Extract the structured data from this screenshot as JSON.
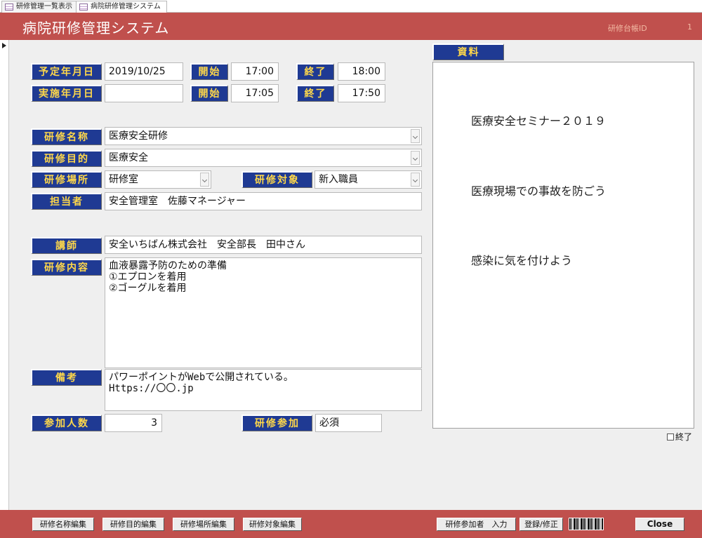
{
  "tabs": [
    {
      "label": "研修管理一覧表示"
    },
    {
      "label": "病院研修管理システム"
    }
  ],
  "header": {
    "title": "病院研修管理システム",
    "id_label": "研修台帳ID",
    "id_value": "1"
  },
  "form": {
    "scheduled_date": {
      "label": "予定年月日",
      "value": "2019/10/25",
      "start_label": "開始",
      "start": "17:00",
      "end_label": "終了",
      "end": "18:00"
    },
    "actual_date": {
      "label": "実施年月日",
      "value": "",
      "start_label": "開始",
      "start": "17:05",
      "end_label": "終了",
      "end": "17:50"
    },
    "training_name": {
      "label": "研修名称",
      "value": "医療安全研修"
    },
    "training_purpose": {
      "label": "研修目的",
      "value": "医療安全"
    },
    "training_place": {
      "label": "研修場所",
      "value": "研修室"
    },
    "training_target": {
      "label": "研修対象",
      "value": "新入職員"
    },
    "person_in_charge": {
      "label": "担当者",
      "value": "安全管理室　佐藤マネージャー"
    },
    "lecturer": {
      "label": "講師",
      "value": "安全いちばん株式会社　安全部長　田中さん"
    },
    "content": {
      "label": "研修内容",
      "value": "血液暴露予防のための準備\n①エプロンを着用\n②ゴーグルを着用"
    },
    "remarks": {
      "label": "備考",
      "value": "パワーポイントがWebで公開されている。\nHttps://〇〇.jp"
    },
    "participants": {
      "label": "参加人数",
      "value": "3"
    },
    "participation": {
      "label": "研修参加",
      "value": "必須"
    }
  },
  "materials": {
    "label": "資料",
    "lines": [
      "医療安全セミナー２０１９",
      "医療現場での事故を防ごう",
      "感染に気を付けよう"
    ]
  },
  "end_checkbox": {
    "label": "終了",
    "checked": false
  },
  "footer": {
    "buttons": [
      "研修名称編集",
      "研修目的編集",
      "研修場所編集",
      "研修対象編集"
    ],
    "participant_input": "研修参加者　入力",
    "register_edit": "登録/修正",
    "close": "Close"
  },
  "colors": {
    "header_bg": "#c0504d",
    "label_bg": "#1f3a93",
    "label_text": "#ffd84a"
  }
}
